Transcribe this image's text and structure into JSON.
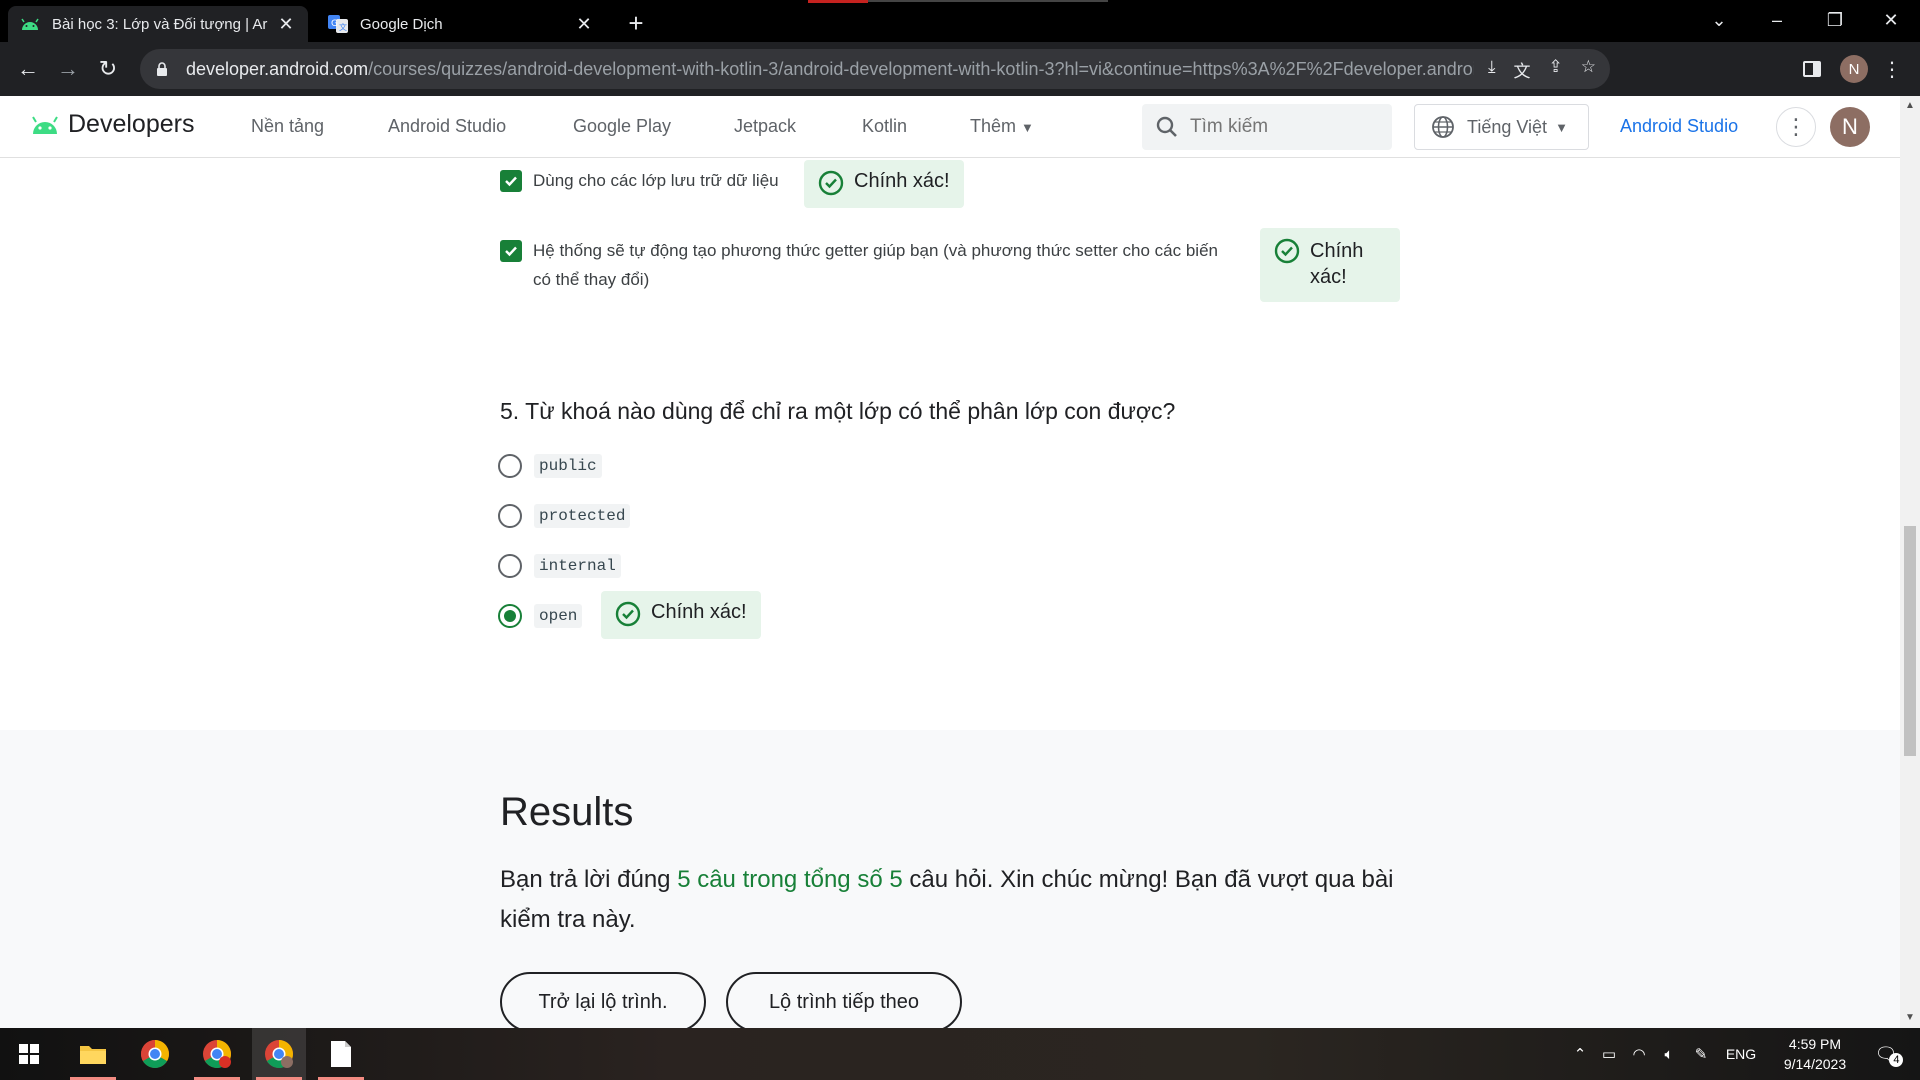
{
  "browser": {
    "tabs": [
      {
        "title": "Bài học 3: Lớp và Đối tượng | Ar",
        "active": true
      },
      {
        "title": "Google Dịch",
        "active": false
      }
    ],
    "url_domain": "developer.android.com",
    "url_path": "/courses/quizzes/android-development-with-kotlin-3/android-development-with-kotlin-3?hl=vi&continue=https%3A%2F%2Fdeveloper.android.com%2Fcourses...",
    "profile_initial": "N"
  },
  "site_header": {
    "logo_text": "Developers",
    "nav": [
      "Nền tảng",
      "Android Studio",
      "Google Play",
      "Jetpack",
      "Kotlin",
      "Thêm"
    ],
    "search_placeholder": "Tìm kiếm",
    "language": "Tiếng Việt",
    "android_studio_link": "Android Studio",
    "avatar_initial": "N"
  },
  "quiz": {
    "prev_answers": [
      {
        "text": "Dùng cho các lớp lưu trữ dữ liệu",
        "checked": true,
        "feedback": "Chính xác!"
      },
      {
        "text": "Hệ thống sẽ tự động tạo phương thức getter giúp bạn (và phương thức setter cho các biến có thể thay đổi)",
        "checked": true,
        "feedback": "Chính xác!"
      }
    ],
    "question5": {
      "text": "5. Từ khoá nào dùng để chỉ ra một lớp có thể phân lớp con được?",
      "options": [
        "public",
        "protected",
        "internal",
        "open"
      ],
      "selected_index": 3,
      "feedback": "Chính xác!"
    }
  },
  "results": {
    "heading": "Results",
    "text_before": "Bạn trả lời đúng ",
    "highlight": "5 câu trong tổng số 5",
    "text_after": " câu hỏi. Xin chúc mừng! Bạn đã vượt qua bài kiểm tra này.",
    "buttons": [
      "Trở lại lộ trình.",
      "Lộ trình tiếp theo"
    ]
  },
  "taskbar": {
    "language": "ENG",
    "time": "4:59 PM",
    "date": "9/14/2023",
    "notification_count": "4"
  },
  "colors": {
    "success_green": "#188038",
    "success_bg": "#e6f4ea",
    "link_blue": "#1a73e8",
    "android_green": "#3ddc84"
  }
}
